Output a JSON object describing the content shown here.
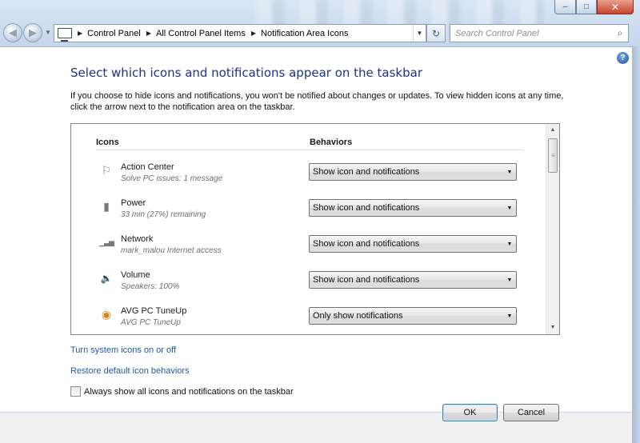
{
  "window": {
    "caption": {
      "minimize": "–",
      "maximize": "□",
      "close": "✕"
    }
  },
  "nav": {
    "back_glyph": "◀",
    "forward_glyph": "▶",
    "dropdown_glyph": "▼",
    "breadcrumbs": [
      "Control Panel",
      "All Control Panel Items",
      "Notification Area Icons"
    ],
    "refresh_glyph": "↻",
    "search_placeholder": "Search Control Panel"
  },
  "page": {
    "title": "Select which icons and notifications appear on the taskbar",
    "description": "If you choose to hide icons and notifications, you won't be notified about changes or updates. To view hidden icons at any time, click the arrow next to the notification area on the taskbar.",
    "help_glyph": "?"
  },
  "list": {
    "col_icons": "Icons",
    "col_behaviors": "Behaviors",
    "rows": [
      {
        "icon": "flag-icon",
        "glyph": "⚐",
        "name": "Action Center",
        "sub": "Solve PC issues: 1 message",
        "behavior": "Show icon and notifications"
      },
      {
        "icon": "battery-icon",
        "glyph": "▮",
        "name": "Power",
        "sub": "33 min (27%) remaining",
        "behavior": "Show icon and notifications"
      },
      {
        "icon": "network-icon",
        "glyph": "▁▃▅",
        "name": "Network",
        "sub": "mark_malou Internet access",
        "behavior": "Show icon and notifications"
      },
      {
        "icon": "speaker-icon",
        "glyph": "🔈",
        "name": "Volume",
        "sub": "Speakers: 100%",
        "behavior": "Show icon and notifications"
      },
      {
        "icon": "avg-tuneup-icon",
        "glyph": "◉",
        "name": "AVG PC TuneUp",
        "sub": "AVG PC TuneUp",
        "behavior": "Only show notifications"
      }
    ]
  },
  "links": {
    "system_icons": "Turn system icons on or off",
    "restore_defaults": "Restore default icon behaviors"
  },
  "always_show": {
    "label": "Always show all icons and notifications on the taskbar",
    "checked": false
  },
  "buttons": {
    "ok": "OK",
    "cancel": "Cancel"
  },
  "colors": {
    "title": "#1e3287",
    "link": "#1e5aa8",
    "ok_border": "#3c7fb1"
  }
}
